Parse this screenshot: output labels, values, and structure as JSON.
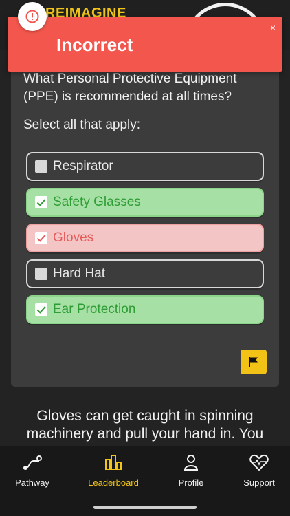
{
  "header": {
    "brand": "REIMAGINE"
  },
  "toast": {
    "title": "Incorrect",
    "close": "×",
    "icon": "alert-icon",
    "color": "#f2564d"
  },
  "question": {
    "text": "What Personal Protective Equipment (PPE) is recommended at all times?",
    "instruction": "Select all that apply:",
    "options": [
      {
        "label": "Respirator",
        "checked": false,
        "state": "neutral"
      },
      {
        "label": "Safety Glasses",
        "checked": true,
        "state": "correct"
      },
      {
        "label": "Gloves",
        "checked": true,
        "state": "wrong"
      },
      {
        "label": "Hard Hat",
        "checked": false,
        "state": "neutral"
      },
      {
        "label": "Ear Protection",
        "checked": true,
        "state": "correct"
      }
    ],
    "flag_icon": "flag-icon"
  },
  "explanation": {
    "text": "Gloves can get caught in spinning machinery and pull your hand in. You"
  },
  "nav": {
    "items": [
      {
        "label": "Pathway",
        "icon": "pathway-icon",
        "active": false
      },
      {
        "label": "Leaderboard",
        "icon": "leaderboard-icon",
        "active": true
      },
      {
        "label": "Profile",
        "icon": "profile-icon",
        "active": false
      },
      {
        "label": "Support",
        "icon": "support-heart-icon",
        "active": false
      }
    ]
  },
  "colors": {
    "accent": "#f0c419",
    "correct_bg": "#a6e0a5",
    "correct_text": "#2e9d35",
    "wrong_bg": "#f3c5c5",
    "wrong_text": "#e55b5b"
  }
}
